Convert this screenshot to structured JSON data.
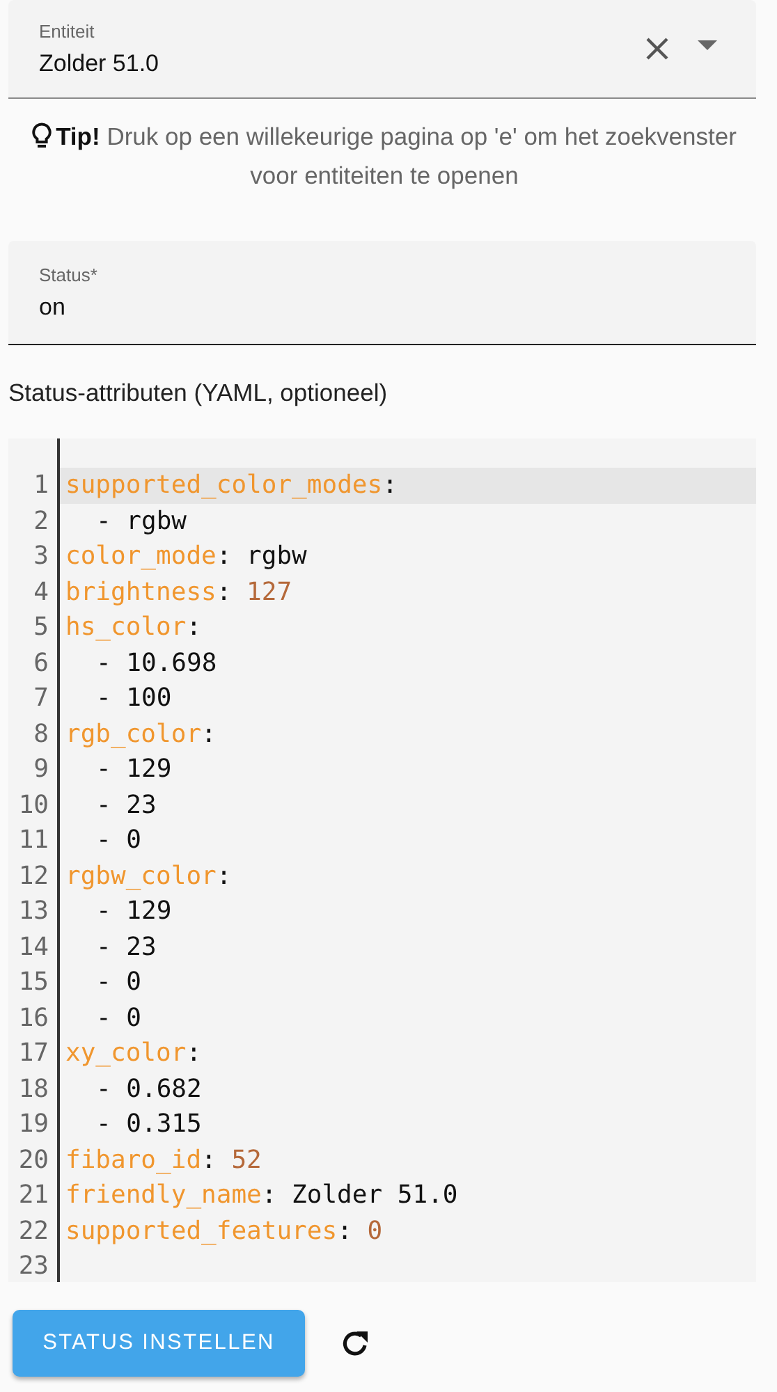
{
  "entity_field": {
    "label": "Entiteit",
    "value": "Zolder 51.0"
  },
  "tip": {
    "title": "Tip!",
    "text": "Druk op een willekeurige pagina op 'e' om het zoekvenster voor entiteiten te openen"
  },
  "status_field": {
    "label": "Status*",
    "value": "on"
  },
  "attributes_label": "Status-attributen (YAML, optioneel)",
  "editor": {
    "lines": [
      {
        "number": "1",
        "kind": "pair",
        "selected": true,
        "tokens": [
          {
            "kind": "key",
            "text": "supported_color_modes"
          },
          {
            "kind": "punct",
            "text": ":"
          }
        ]
      },
      {
        "number": "2",
        "kind": "item",
        "selected": false,
        "tokens": [
          {
            "kind": "plain",
            "text": "- rgbw"
          }
        ]
      },
      {
        "number": "3",
        "kind": "pair",
        "selected": false,
        "tokens": [
          {
            "kind": "key",
            "text": "color_mode"
          },
          {
            "kind": "punct",
            "text": ":"
          },
          {
            "kind": "string",
            "text": "rgbw"
          }
        ]
      },
      {
        "number": "4",
        "kind": "pair",
        "selected": false,
        "tokens": [
          {
            "kind": "key",
            "text": "brightness"
          },
          {
            "kind": "punct",
            "text": ":"
          },
          {
            "kind": "number",
            "text": "127"
          }
        ]
      },
      {
        "number": "5",
        "kind": "pair",
        "selected": false,
        "tokens": [
          {
            "kind": "key",
            "text": "hs_color"
          },
          {
            "kind": "punct",
            "text": ":"
          }
        ]
      },
      {
        "number": "6",
        "kind": "item",
        "selected": false,
        "tokens": [
          {
            "kind": "plain",
            "text": "- 10.698"
          }
        ]
      },
      {
        "number": "7",
        "kind": "item",
        "selected": false,
        "tokens": [
          {
            "kind": "plain",
            "text": "- 100"
          }
        ]
      },
      {
        "number": "8",
        "kind": "pair",
        "selected": false,
        "tokens": [
          {
            "kind": "key",
            "text": "rgb_color"
          },
          {
            "kind": "punct",
            "text": ":"
          }
        ]
      },
      {
        "number": "9",
        "kind": "item",
        "selected": false,
        "tokens": [
          {
            "kind": "plain",
            "text": "- 129"
          }
        ]
      },
      {
        "number": "10",
        "kind": "item",
        "selected": false,
        "tokens": [
          {
            "kind": "plain",
            "text": "- 23"
          }
        ]
      },
      {
        "number": "11",
        "kind": "item",
        "selected": false,
        "tokens": [
          {
            "kind": "plain",
            "text": "- 0"
          }
        ]
      },
      {
        "number": "12",
        "kind": "pair",
        "selected": false,
        "tokens": [
          {
            "kind": "key",
            "text": "rgbw_color"
          },
          {
            "kind": "punct",
            "text": ":"
          }
        ]
      },
      {
        "number": "13",
        "kind": "item",
        "selected": false,
        "tokens": [
          {
            "kind": "plain",
            "text": "- 129"
          }
        ]
      },
      {
        "number": "14",
        "kind": "item",
        "selected": false,
        "tokens": [
          {
            "kind": "plain",
            "text": "- 23"
          }
        ]
      },
      {
        "number": "15",
        "kind": "item",
        "selected": false,
        "tokens": [
          {
            "kind": "plain",
            "text": "- 0"
          }
        ]
      },
      {
        "number": "16",
        "kind": "item",
        "selected": false,
        "tokens": [
          {
            "kind": "plain",
            "text": "- 0"
          }
        ]
      },
      {
        "number": "17",
        "kind": "pair",
        "selected": false,
        "tokens": [
          {
            "kind": "key",
            "text": "xy_color"
          },
          {
            "kind": "punct",
            "text": ":"
          }
        ]
      },
      {
        "number": "18",
        "kind": "item",
        "selected": false,
        "tokens": [
          {
            "kind": "plain",
            "text": "- 0.682"
          }
        ]
      },
      {
        "number": "19",
        "kind": "item",
        "selected": false,
        "tokens": [
          {
            "kind": "plain",
            "text": "- 0.315"
          }
        ]
      },
      {
        "number": "20",
        "kind": "pair",
        "selected": false,
        "tokens": [
          {
            "kind": "key",
            "text": "fibaro_id"
          },
          {
            "kind": "punct",
            "text": ":"
          },
          {
            "kind": "number",
            "text": "52"
          }
        ]
      },
      {
        "number": "21",
        "kind": "pair",
        "selected": false,
        "tokens": [
          {
            "kind": "key",
            "text": "friendly_name"
          },
          {
            "kind": "punct",
            "text": ":"
          },
          {
            "kind": "string",
            "text": "Zolder 51.0"
          }
        ]
      },
      {
        "number": "22",
        "kind": "pair",
        "selected": false,
        "tokens": [
          {
            "kind": "key",
            "text": "supported_features"
          },
          {
            "kind": "punct",
            "text": ":"
          },
          {
            "kind": "number",
            "text": "0"
          }
        ]
      },
      {
        "number": "23",
        "kind": "empty",
        "selected": false
      }
    ]
  },
  "set_button": {
    "label": "STATUS INSTELLEN"
  }
}
